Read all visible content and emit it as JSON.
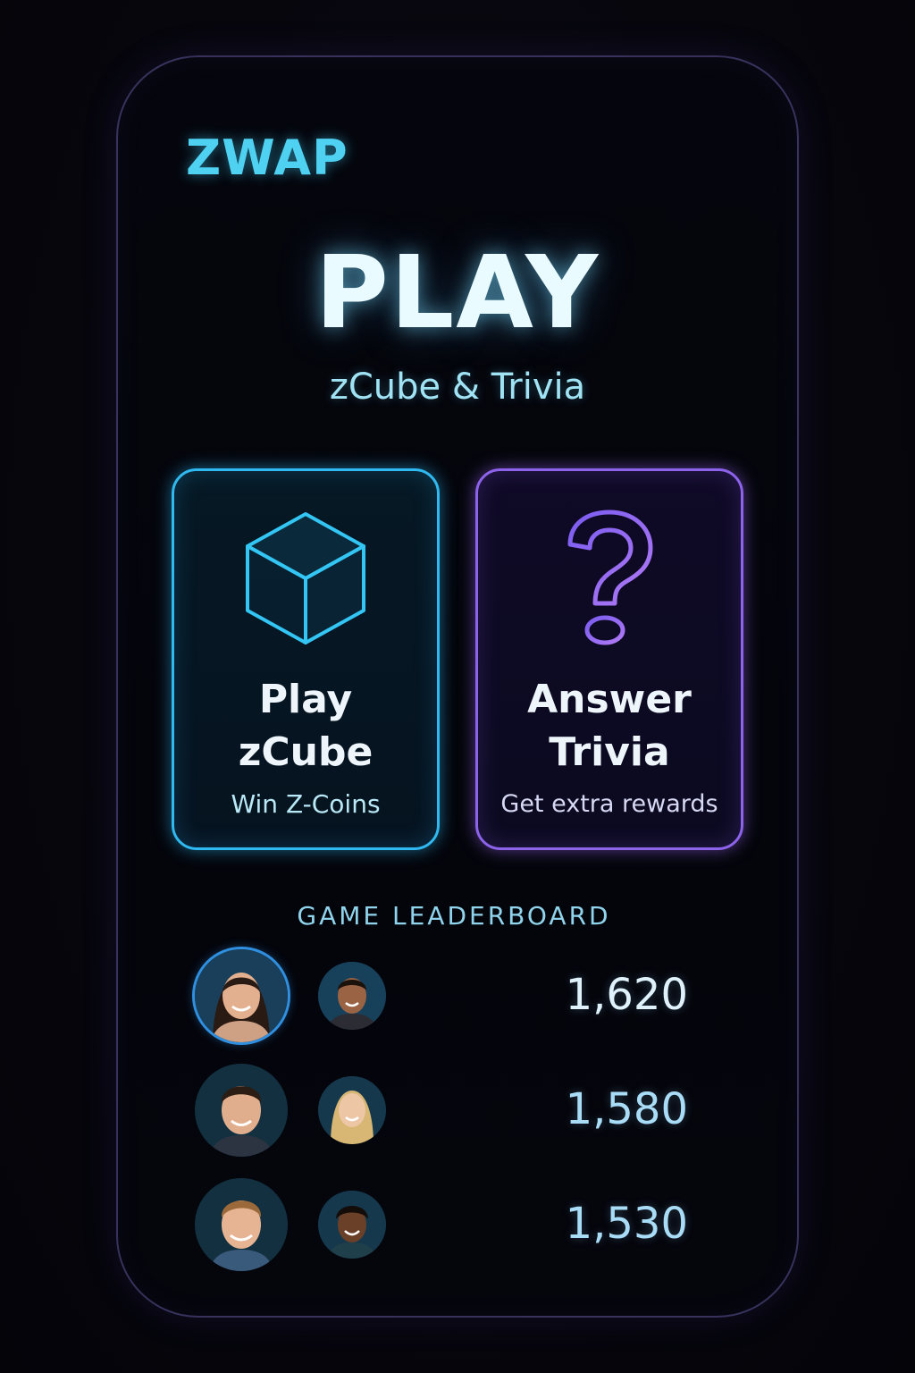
{
  "app": {
    "brand": "ZWAP"
  },
  "hero": {
    "title": "PLAY",
    "subtitle": "zCube & Trivia"
  },
  "cards": [
    {
      "title_line1": "Play",
      "title_line2": "zCube",
      "subtitle": "Win Z-Coins",
      "icon": "cube-icon",
      "accent": "#2fb9f0"
    },
    {
      "title_line1": "Answer",
      "title_line2": "Trivia",
      "subtitle": "Get extra rewards",
      "icon": "question-mark-icon",
      "accent": "#8c63ea"
    }
  ],
  "leaderboard": {
    "heading": "GAME LEADERBOARD",
    "rows": [
      {
        "score": "1,620",
        "highlighted": true
      },
      {
        "score": "1,580",
        "highlighted": false
      },
      {
        "score": "1,530",
        "highlighted": false
      }
    ]
  },
  "colors": {
    "background": "#07060d",
    "brand": "#4fd2f2",
    "cube_accent": "#2fb9f0",
    "trivia_accent": "#8c63ea",
    "highlight_ring": "#2f8fe0"
  }
}
